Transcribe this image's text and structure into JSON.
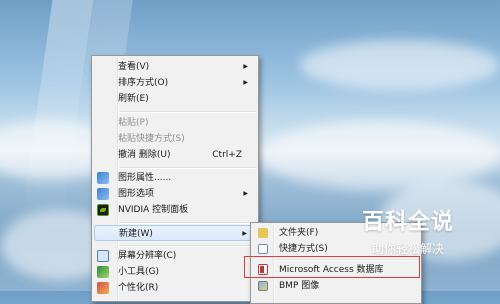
{
  "context_menu": {
    "items": [
      {
        "label": "查看(V)",
        "submenu": true
      },
      {
        "label": "排序方式(O)",
        "submenu": true
      },
      {
        "label": "刷新(E)"
      },
      {
        "label": "粘贴(P)",
        "disabled": true
      },
      {
        "label": "粘贴快捷方式(S)",
        "disabled": true
      },
      {
        "label": "撤消 删除(U)",
        "shortcut": "Ctrl+Z"
      },
      {
        "label": "图形属性......",
        "icon": "graphics-icon"
      },
      {
        "label": "图形选项",
        "icon": "graphics-options-icon",
        "submenu": true
      },
      {
        "label": "NVIDIA 控制面板",
        "icon": "nvidia-icon"
      },
      {
        "label": "新建(W)",
        "submenu": true,
        "selected": true
      },
      {
        "label": "屏幕分辨率(C)",
        "icon": "screen-resolution-icon"
      },
      {
        "label": "小工具(G)",
        "icon": "gadget-icon"
      },
      {
        "label": "个性化(R)",
        "icon": "personalize-icon"
      }
    ]
  },
  "new_submenu": {
    "items": [
      {
        "label": "文件夹(F)",
        "icon": "folder-icon"
      },
      {
        "label": "快捷方式(S)",
        "icon": "shortcut-icon"
      },
      {
        "label": "Microsoft Access 数据库",
        "icon": "access-icon"
      },
      {
        "label": "BMP 图像",
        "icon": "bmp-icon"
      }
    ]
  },
  "watermark": {
    "title": "百科全说",
    "subtitle": "助你轻松解决"
  },
  "colors": {
    "highlight_border": "#e23b3b",
    "menu_background": "#f1f1f1",
    "selected_item": "#d9e8fa"
  }
}
